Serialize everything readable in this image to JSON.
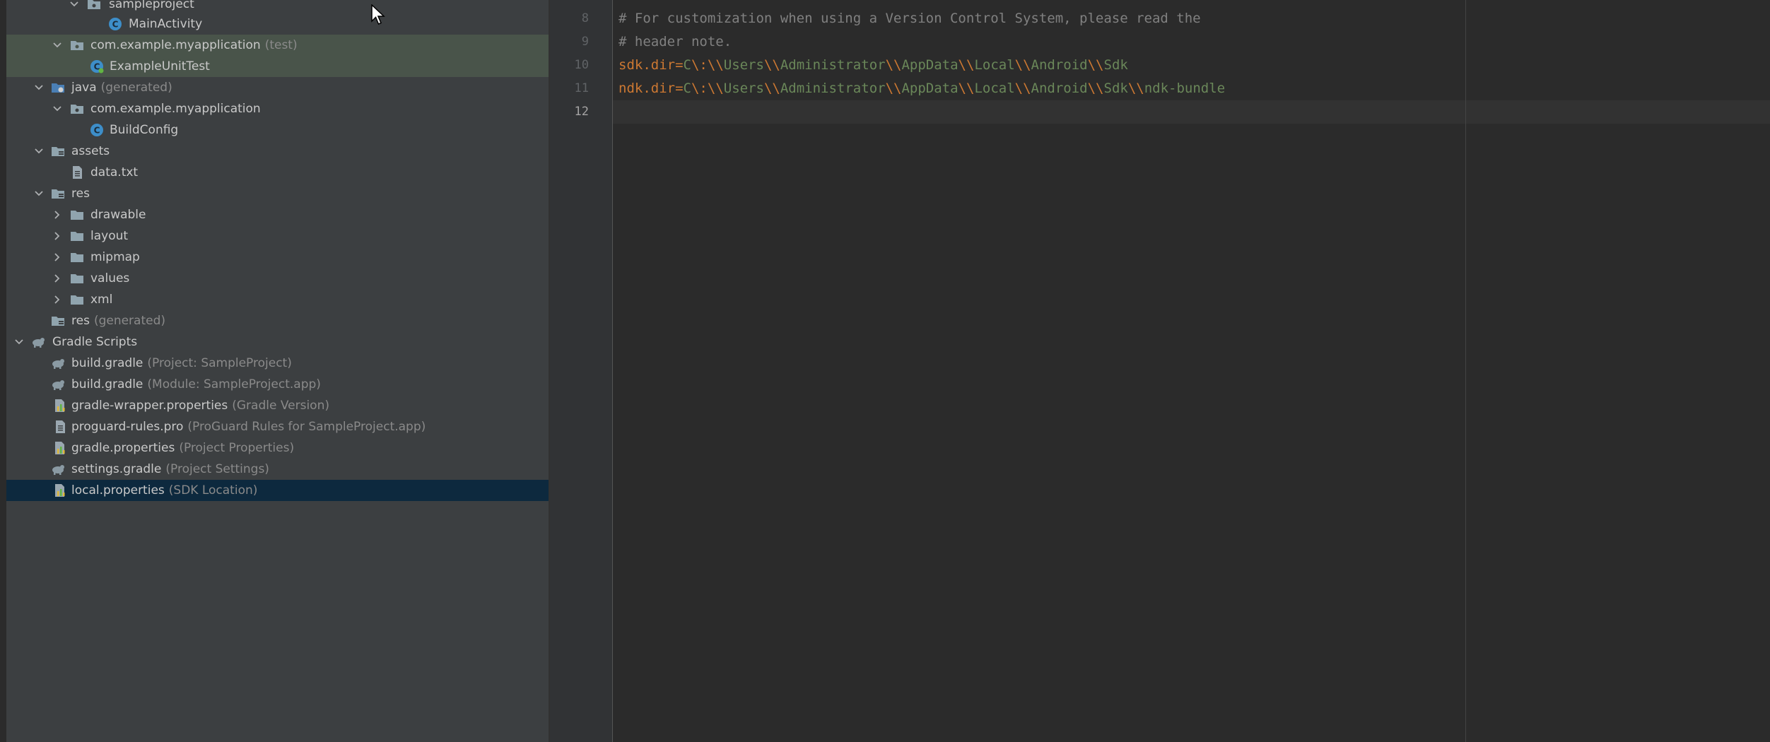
{
  "project_tree": {
    "rows": [
      {
        "label": "sampleproject",
        "hint": "",
        "icon": "package-folder-icon",
        "expanded": true
      },
      {
        "label": "MainActivity",
        "hint": "",
        "icon": "class-icon"
      },
      {
        "label": "com.example.myapplication",
        "hint": "(test)",
        "icon": "package-folder-icon",
        "expanded": true
      },
      {
        "label": "ExampleUnitTest",
        "hint": "",
        "icon": "test-class-icon"
      },
      {
        "label": "java",
        "hint": "(generated)",
        "icon": "generated-source-folder-icon",
        "expanded": true
      },
      {
        "label": "com.example.myapplication",
        "hint": "",
        "icon": "package-folder-icon",
        "expanded": true
      },
      {
        "label": "BuildConfig",
        "hint": "",
        "icon": "class-icon"
      },
      {
        "label": "assets",
        "hint": "",
        "icon": "resource-folder-icon",
        "expanded": true
      },
      {
        "label": "data.txt",
        "hint": "",
        "icon": "text-file-icon"
      },
      {
        "label": "res",
        "hint": "",
        "icon": "resource-folder-icon",
        "expanded": true
      },
      {
        "label": "drawable",
        "hint": "",
        "icon": "folder-icon",
        "expanded": false
      },
      {
        "label": "layout",
        "hint": "",
        "icon": "folder-icon",
        "expanded": false
      },
      {
        "label": "mipmap",
        "hint": "",
        "icon": "folder-icon",
        "expanded": false
      },
      {
        "label": "values",
        "hint": "",
        "icon": "folder-icon",
        "expanded": false
      },
      {
        "label": "xml",
        "hint": "",
        "icon": "folder-icon",
        "expanded": false
      },
      {
        "label": "res",
        "hint": "(generated)",
        "icon": "resource-folder-icon"
      },
      {
        "label": "Gradle Scripts",
        "hint": "",
        "icon": "gradle-icon",
        "expanded": true
      },
      {
        "label": "build.gradle",
        "hint": "(Project: SampleProject)",
        "icon": "gradle-icon"
      },
      {
        "label": "build.gradle",
        "hint": "(Module: SampleProject.app)",
        "icon": "gradle-icon"
      },
      {
        "label": "gradle-wrapper.properties",
        "hint": "(Gradle Version)",
        "icon": "properties-file-icon"
      },
      {
        "label": "proguard-rules.pro",
        "hint": "(ProGuard Rules for SampleProject.app)",
        "icon": "text-file-icon"
      },
      {
        "label": "gradle.properties",
        "hint": "(Project Properties)",
        "icon": "properties-file-icon"
      },
      {
        "label": "settings.gradle",
        "hint": "(Project Settings)",
        "icon": "gradle-icon"
      },
      {
        "label": "local.properties",
        "hint": "(SDK Location)",
        "icon": "properties-file-icon",
        "selected": true
      }
    ]
  },
  "editor": {
    "file": "local.properties",
    "current_line": 12,
    "lines": [
      {
        "n": "8",
        "comment": "# For customization when using a Version Control System, please read the"
      },
      {
        "n": "9",
        "comment": "# header note."
      },
      {
        "n": "10",
        "key": "sdk.dir",
        "eq": "=",
        "value": "C\\:\\\\Users\\\\Administrator\\\\AppData\\\\Local\\\\Android\\\\Sdk"
      },
      {
        "n": "11",
        "key": "ndk.dir",
        "eq": "=",
        "value": "C\\:\\\\Users\\\\Administrator\\\\AppData\\\\Local\\\\Android\\\\Sdk\\\\ndk-bundle"
      },
      {
        "n": "12",
        "comment": ""
      }
    ]
  },
  "colors": {
    "tree_bg": "#3c3f41",
    "editor_bg": "#2b2b2b",
    "selection": "#0d293e",
    "test_highlight": "#49544a",
    "keyword": "#cc7832",
    "string": "#6a8759",
    "comment": "#808080"
  }
}
